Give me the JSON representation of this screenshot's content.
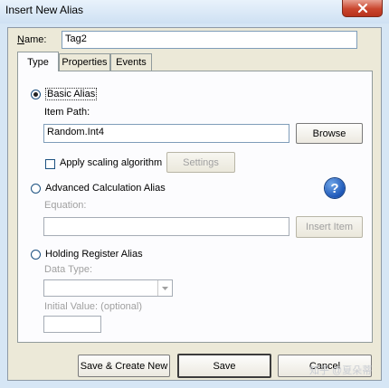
{
  "window": {
    "title": "Insert New Alias",
    "close_icon": "close-icon",
    "close_color": "#c9452d"
  },
  "name_field": {
    "label": "Name:",
    "value": "Tag2"
  },
  "tabs": [
    {
      "label": "Type",
      "selected": true
    },
    {
      "label": "Properties",
      "selected": false
    },
    {
      "label": "Events",
      "selected": false
    }
  ],
  "basic_alias": {
    "label": "Basic Alias",
    "selected": true,
    "item_path_label": "Item Path:",
    "item_path_value": "Random.Int4",
    "browse_label": "Browse",
    "scaling_label": "Apply scaling algorithm",
    "scaling_checked": false,
    "settings_label": "Settings"
  },
  "advanced_alias": {
    "label": "Advanced Calculation Alias",
    "selected": false,
    "equation_label": "Equation:",
    "equation_value": "",
    "insert_item_label": "Insert Item",
    "help_icon": "help-icon"
  },
  "holding_register": {
    "label": "Holding Register Alias",
    "selected": false,
    "data_type_label": "Data Type:",
    "data_type_value": "",
    "initial_value_label": "Initial Value: (optional)",
    "initial_value": ""
  },
  "footer": {
    "save_create_new_label": "Save & Create New",
    "save_label": "Save",
    "cancel_label": "Cancel"
  },
  "watermark": "知乎 @夏朵蒂"
}
